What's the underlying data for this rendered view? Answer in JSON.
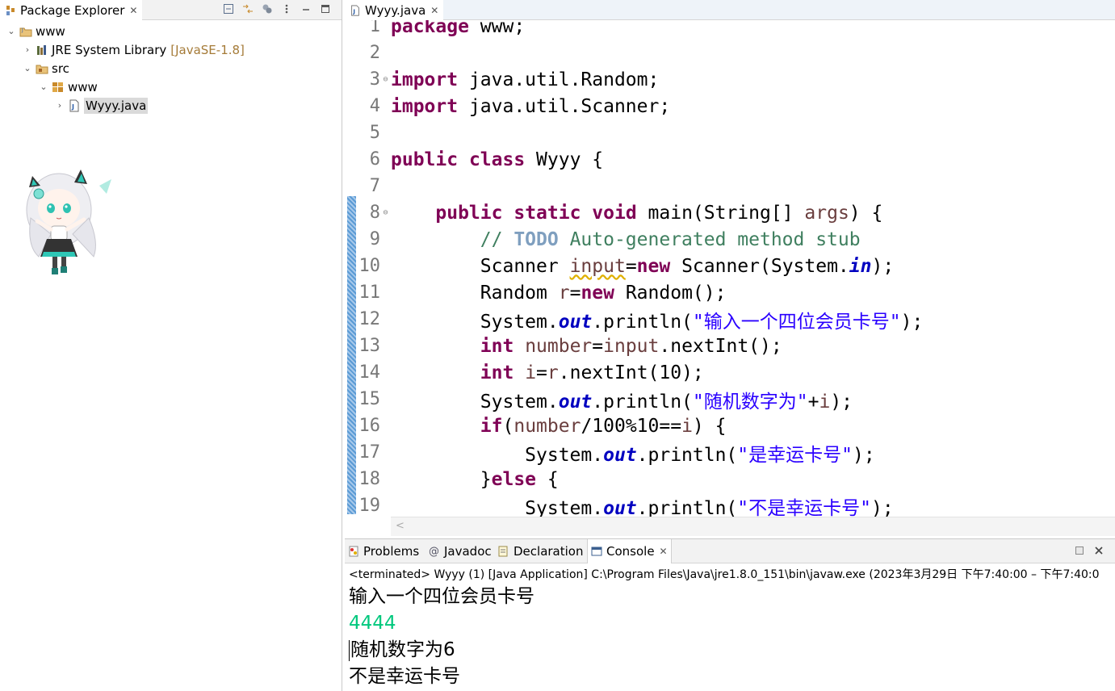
{
  "explorer": {
    "tab_label": "Package Explorer",
    "close_glyph": "✕",
    "tree": {
      "project": "www",
      "jre_label": "JRE System Library",
      "jre_decor": "[JavaSE-1.8]",
      "src": "src",
      "package": "www",
      "file": "Wyyy.java"
    }
  },
  "editor": {
    "tab_label": "Wyyy.java",
    "hscroll_glyph": "<",
    "line_numbers": [
      "1",
      "2",
      "3",
      "4",
      "5",
      "6",
      "7",
      "8",
      "9",
      "10",
      "11",
      "12",
      "13",
      "14",
      "15",
      "16",
      "17",
      "18",
      "19"
    ],
    "code": {
      "l1_kw": "package",
      "l1_rest": " www;",
      "l3_kw": "import",
      "l3_rest": " java.util.Random;",
      "l4_kw": "import",
      "l4_rest": " java.util.Scanner;",
      "l6_kw1": "public",
      "l6_kw2": "class",
      "l6_rest": " Wyyy {",
      "l8_kw1": "public",
      "l8_kw2": "static",
      "l8_kw3": "void",
      "l8_a": " main(String[] ",
      "l8_var": "args",
      "l8_b": ") {",
      "l9_a": "// ",
      "l9_todo": "TODO",
      "l9_b": " Auto-generated method stub",
      "l10_a": "Scanner ",
      "l10_var": "input",
      "l10_b": "=",
      "l10_kw": "new",
      "l10_c": " Scanner(System.",
      "l10_fld": "in",
      "l10_d": ");",
      "l11_a": "Random ",
      "l11_var": "r",
      "l11_b": "=",
      "l11_kw": "new",
      "l11_c": " Random();",
      "l12_a": "System.",
      "l12_fld": "out",
      "l12_b": ".println(",
      "l12_str": "\"输入一个四位会员卡号\"",
      "l12_c": ");",
      "l13_kw": "int",
      "l13_var1": "number",
      "l13_a": "=",
      "l13_var2": "input",
      "l13_b": ".nextInt();",
      "l14_kw": "int",
      "l14_var1": "i",
      "l14_a": "=",
      "l14_var2": "r",
      "l14_b": ".nextInt(10);",
      "l15_a": "System.",
      "l15_fld": "out",
      "l15_b": ".println(",
      "l15_str": "\"随机数字为\"",
      "l15_c": "+",
      "l15_var": "i",
      "l15_d": ");",
      "l16_kw": "if",
      "l16_a": "(",
      "l16_var1": "number",
      "l16_b": "/100%10==",
      "l16_var2": "i",
      "l16_c": ") {",
      "l17_a": "System.",
      "l17_fld": "out",
      "l17_b": ".println(",
      "l17_str": "\"是幸运卡号\"",
      "l17_c": ");",
      "l18_a": "}",
      "l18_kw": "else",
      "l18_b": " {",
      "l19_a": "System.",
      "l19_fld": "out",
      "l19_b": ".println(",
      "l19_str": "\"不是幸运卡号\"",
      "l19_c": ");"
    }
  },
  "console": {
    "tabs": [
      "Problems",
      "Javadoc",
      "Declaration",
      "Console"
    ],
    "status": "<terminated> Wyyy (1) [Java Application] C:\\Program Files\\Java\\jre1.8.0_151\\bin\\javaw.exe  (2023年3月29日 下午7:40:00 – 下午7:40:0",
    "output": {
      "line1": "输入一个四位会员卡号",
      "line2": "4444",
      "line3": "随机数字为6",
      "line4": "不是幸运卡号"
    }
  },
  "colors": {
    "keyword": "#7f0055",
    "string": "#2a00ff",
    "comment": "#3f7f5f",
    "field": "#0000c0",
    "local_var": "#6a3e3e",
    "console_input": "#00c87d",
    "current_line": "#e8f2fe"
  }
}
